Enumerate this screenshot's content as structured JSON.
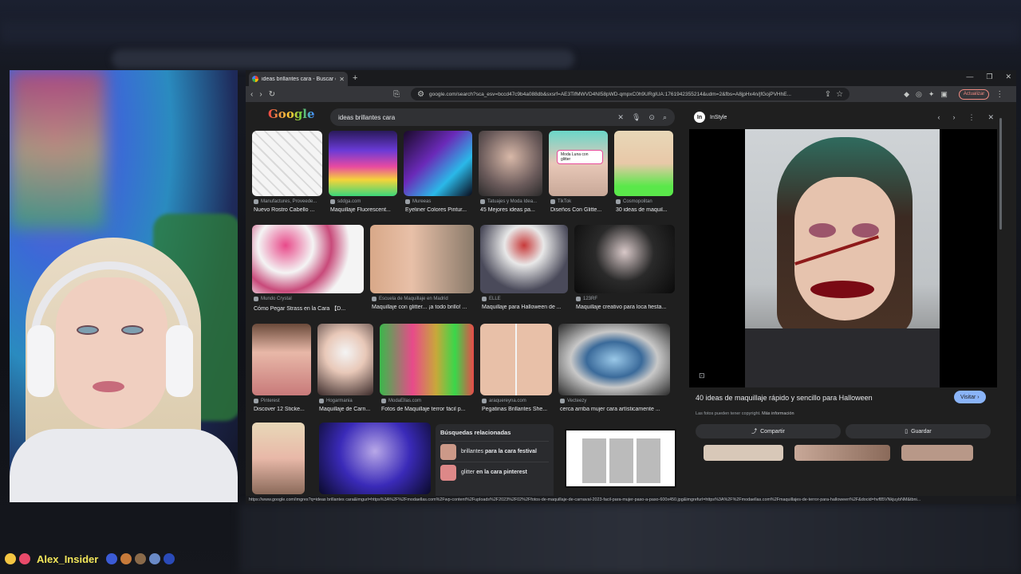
{
  "browser": {
    "tab_title": "ideas brillantes cara - Buscar co",
    "url": "google.com/search?sca_esv=bccd47c9b4a088db&sxsrf=AE3TifMWVD4NI58pWD-qmpxC0h9URgIUA:1761942355214&udm=2&fbs=A8jpHx4n/jfGojPVHhE...",
    "update_label": "Actualizar"
  },
  "search": {
    "query": "ideas brillantes cara"
  },
  "results": {
    "row1": [
      {
        "source": "Manufactures, Proveede...",
        "caption": "Nuevo Rostro Cabello ..."
      },
      {
        "source": "sddga.com",
        "caption": "Maquillaje Fluorescent..."
      },
      {
        "source": "Mureeas",
        "caption": "Eyeliner Colores Pintur..."
      },
      {
        "source": "Tatuajes y Moda Idea...",
        "caption": "45 Mejores ideas pa..."
      },
      {
        "source": "TikTok",
        "caption": "Diseños Con Glitte..."
      },
      {
        "source": "Cosmopolitan",
        "caption": "30 ideas de maquil..."
      }
    ],
    "row2": [
      {
        "source": "Mundo Crystal",
        "caption": "Cómo Pegar Strass en la Cara 【D..."
      },
      {
        "source": "Escuela de Maquillaje en Madrid",
        "caption": "Maquillaje con glitter... ¡a todo brillo! ..."
      },
      {
        "source": "ELLE",
        "caption": "Maquillaje para Halloween de ..."
      },
      {
        "source": "123RF",
        "caption": "Maquillaje creativo para loca fiesta..."
      }
    ],
    "row3": [
      {
        "source": "Pinterest",
        "caption": "Discover 12 Sticke..."
      },
      {
        "source": "Hogarmania",
        "caption": "Maquillaje de Carn..."
      },
      {
        "source": "ModaEllas.com",
        "caption": "Fotos de Maquillaje terror fácil p..."
      },
      {
        "source": "araquereyna.com",
        "caption": "Pegatinas Brillantes She..."
      },
      {
        "source": "Vecteezy",
        "caption": "cerca arriba mujer cara artísticamente ..."
      }
    ],
    "tiktok_overlay": "Moda Luna con glitter"
  },
  "related": {
    "heading": "Búsquedas relacionadas",
    "items": [
      {
        "pre": "brillantes ",
        "bold": "para la cara festival"
      },
      {
        "pre": "glitter ",
        "bold": "en la cara pinterest"
      }
    ]
  },
  "side_panel": {
    "source_name": "InStyle",
    "title": "40 ideas de maquillaje rápido y sencillo para Halloween",
    "visit_label": "Visitar",
    "note": "Las fotos pueden tener copyright.",
    "note_link": "Más información",
    "share_label": "Compartir",
    "save_label": "Guardar"
  },
  "status_url": "https://www.google.com/imgres?q=ideas brillantes cara&imgurl=https%3A%2F%2Fmodaellas.com%2Fwp-content%2Fuploads%2F2023%2F02%2Ffotos-de-maquillaje-de-carnaval-2023-facil-para-mujer-paso-a-paso-600x450.jpg&imgrefurl=https%3A%2F%2Fmodaellas.com%2Fmaquillajes-de-terror-para-halloween%2F&docid=hvf85VNkjuybNM&tbni...",
  "stream": {
    "username": "Alex_Insider"
  }
}
